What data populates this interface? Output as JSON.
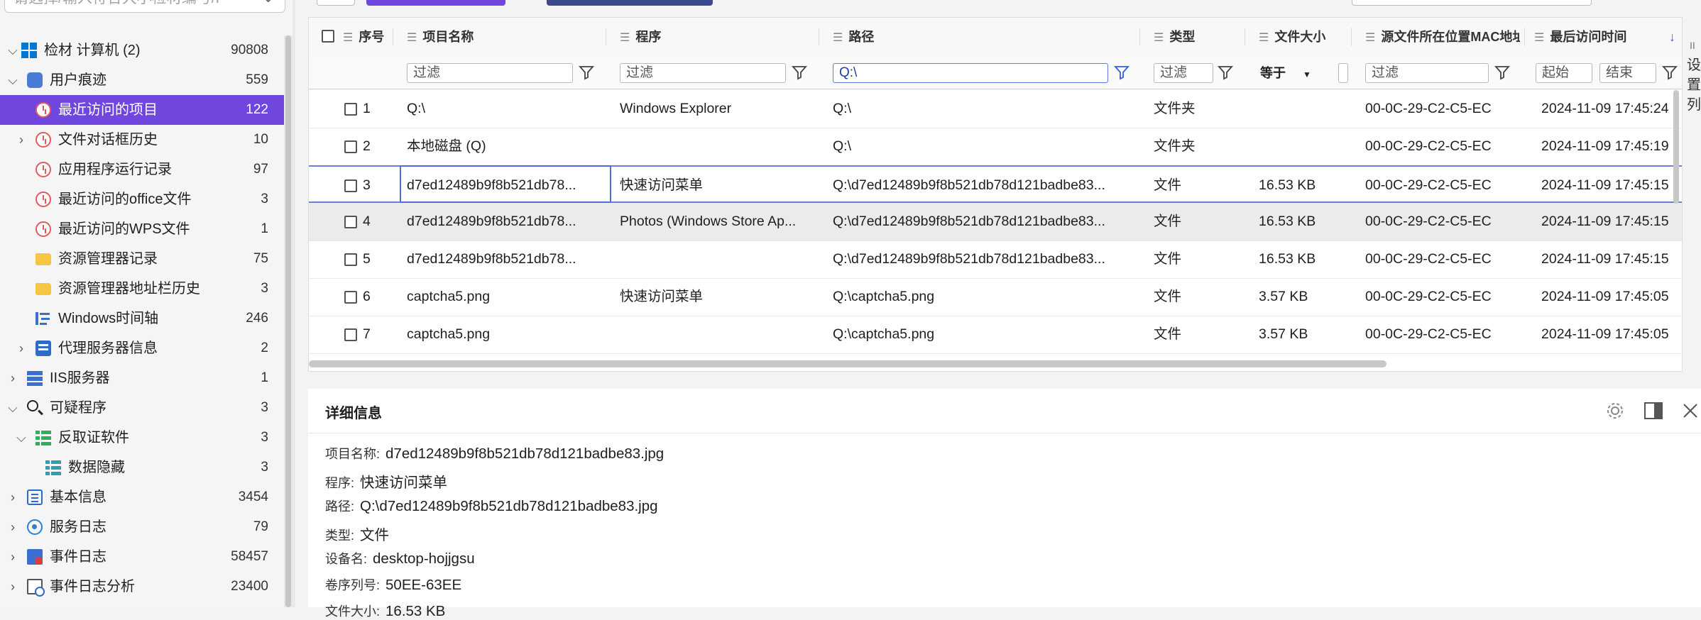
{
  "search": {
    "placeholder": "请选择/输入符合大小检材编号/P"
  },
  "tree": [
    {
      "label": "检材 计算机 (2)",
      "count": "90808",
      "icon": "windows-icon",
      "level": 0,
      "arrow": "expanded"
    },
    {
      "label": "用户痕迹",
      "count": "559",
      "icon": "user-trace-icon",
      "level": 1,
      "arrow": "expanded"
    },
    {
      "label": "最近访问的项目",
      "count": "122",
      "icon": "clock-icon",
      "level": 2,
      "arrow": "none",
      "selected": true
    },
    {
      "label": "文件对话框历史",
      "count": "10",
      "icon": "clock-icon",
      "level": 2,
      "arrow": "collapsed"
    },
    {
      "label": "应用程序运行记录",
      "count": "97",
      "icon": "clock-icon",
      "level": 2,
      "arrow": "none"
    },
    {
      "label": "最近访问的office文件",
      "count": "3",
      "icon": "clock-icon",
      "level": 2,
      "arrow": "none"
    },
    {
      "label": "最近访问的WPS文件",
      "count": "1",
      "icon": "clock-icon",
      "level": 2,
      "arrow": "none"
    },
    {
      "label": "资源管理器记录",
      "count": "75",
      "icon": "folder-icon",
      "level": 2,
      "arrow": "none"
    },
    {
      "label": "资源管理器地址栏历史",
      "count": "3",
      "icon": "folder-icon",
      "level": 2,
      "arrow": "none"
    },
    {
      "label": "Windows时间轴",
      "count": "246",
      "icon": "timeline-icon",
      "level": 2,
      "arrow": "none"
    },
    {
      "label": "代理服务器信息",
      "count": "2",
      "icon": "proxy-icon",
      "level": 2,
      "arrow": "collapsed"
    },
    {
      "label": "IIS服务器",
      "count": "1",
      "icon": "server-icon",
      "level": 1,
      "arrow": "collapsed"
    },
    {
      "label": "可疑程序",
      "count": "3",
      "icon": "magnifier-icon",
      "level": 1,
      "arrow": "expanded"
    },
    {
      "label": "反取证软件",
      "count": "3",
      "icon": "anti-forensic-icon",
      "level": 2,
      "arrow": "expanded"
    },
    {
      "label": "数据隐藏",
      "count": "3",
      "icon": "data-hiding-icon",
      "level": 3,
      "arrow": "none"
    },
    {
      "label": "基本信息",
      "count": "3454",
      "icon": "basic-info-icon",
      "level": 1,
      "arrow": "collapsed"
    },
    {
      "label": "服务日志",
      "count": "79",
      "icon": "service-log-icon",
      "level": 1,
      "arrow": "collapsed"
    },
    {
      "label": "事件日志",
      "count": "58457",
      "icon": "event-log-icon",
      "level": 1,
      "arrow": "collapsed"
    },
    {
      "label": "事件日志分析",
      "count": "23400",
      "icon": "event-analysis-icon",
      "level": 1,
      "arrow": "collapsed"
    }
  ],
  "grid": {
    "columns": [
      "序号",
      "项目名称",
      "程序",
      "路径",
      "类型",
      "文件大小",
      "源文件所在位置MAC地址",
      "最后访问时间"
    ],
    "filters": {
      "name": "过滤",
      "program": "过滤",
      "path": "Q:\\",
      "type": "过滤",
      "size_op": "等于",
      "mac": "过滤",
      "time_start": "起始",
      "time_end": "结束"
    },
    "rows": [
      {
        "no": "1",
        "name": "Q:\\",
        "program": "Windows Explorer",
        "path": "Q:\\",
        "type": "文件夹",
        "size": "",
        "mac": "00-0C-29-C2-C5-EC",
        "time": "2024-11-09 17:45:24"
      },
      {
        "no": "2",
        "name": "本地磁盘 (Q)",
        "program": "",
        "path": "Q:\\",
        "type": "文件夹",
        "size": "",
        "mac": "00-0C-29-C2-C5-EC",
        "time": "2024-11-09 17:45:19"
      },
      {
        "no": "3",
        "name": "d7ed12489b9f8b521db78...",
        "program": "快速访问菜单",
        "path": "Q:\\d7ed12489b9f8b521db78d121badbe83...",
        "type": "文件",
        "size": "16.53 KB",
        "mac": "00-0C-29-C2-C5-EC",
        "time": "2024-11-09 17:45:15"
      },
      {
        "no": "4",
        "name": "d7ed12489b9f8b521db78...",
        "program": "Photos (Windows Store Ap...",
        "path": "Q:\\d7ed12489b9f8b521db78d121badbe83...",
        "type": "文件",
        "size": "16.53 KB",
        "mac": "00-0C-29-C2-C5-EC",
        "time": "2024-11-09 17:45:15"
      },
      {
        "no": "5",
        "name": "d7ed12489b9f8b521db78...",
        "program": "",
        "path": "Q:\\d7ed12489b9f8b521db78d121badbe83...",
        "type": "文件",
        "size": "16.53 KB",
        "mac": "00-0C-29-C2-C5-EC",
        "time": "2024-11-09 17:45:15"
      },
      {
        "no": "6",
        "name": "captcha5.png",
        "program": "快速访问菜单",
        "path": "Q:\\captcha5.png",
        "type": "文件",
        "size": "3.57 KB",
        "mac": "00-0C-29-C2-C5-EC",
        "time": "2024-11-09 17:45:05"
      },
      {
        "no": "7",
        "name": "captcha5.png",
        "program": "",
        "path": "Q:\\captcha5.png",
        "type": "文件",
        "size": "3.57 KB",
        "mac": "00-0C-29-C2-C5-EC",
        "time": "2024-11-09 17:45:05"
      }
    ]
  },
  "edge_text": [
    "设",
    "置",
    "列"
  ],
  "detail": {
    "title": "详细信息",
    "lines": [
      {
        "key": "项目名称:",
        "value": "d7ed12489b9f8b521db78d121badbe83.jpg"
      },
      {
        "key": "程序:",
        "value": "快速访问菜单"
      },
      {
        "key": "路径:",
        "value": "Q:\\d7ed12489b9f8b521db78d121badbe83.jpg"
      },
      {
        "key": "类型:",
        "value": "文件"
      },
      {
        "key": "设备名:",
        "value": "desktop-hojjgsu"
      },
      {
        "key": "卷序列号:",
        "value": "50EE-63EE"
      },
      {
        "key": "文件大小:",
        "value": "16.53 KB"
      }
    ]
  },
  "colors": {
    "accent": "#6f47df",
    "active_filter": "#5a7bd8"
  }
}
